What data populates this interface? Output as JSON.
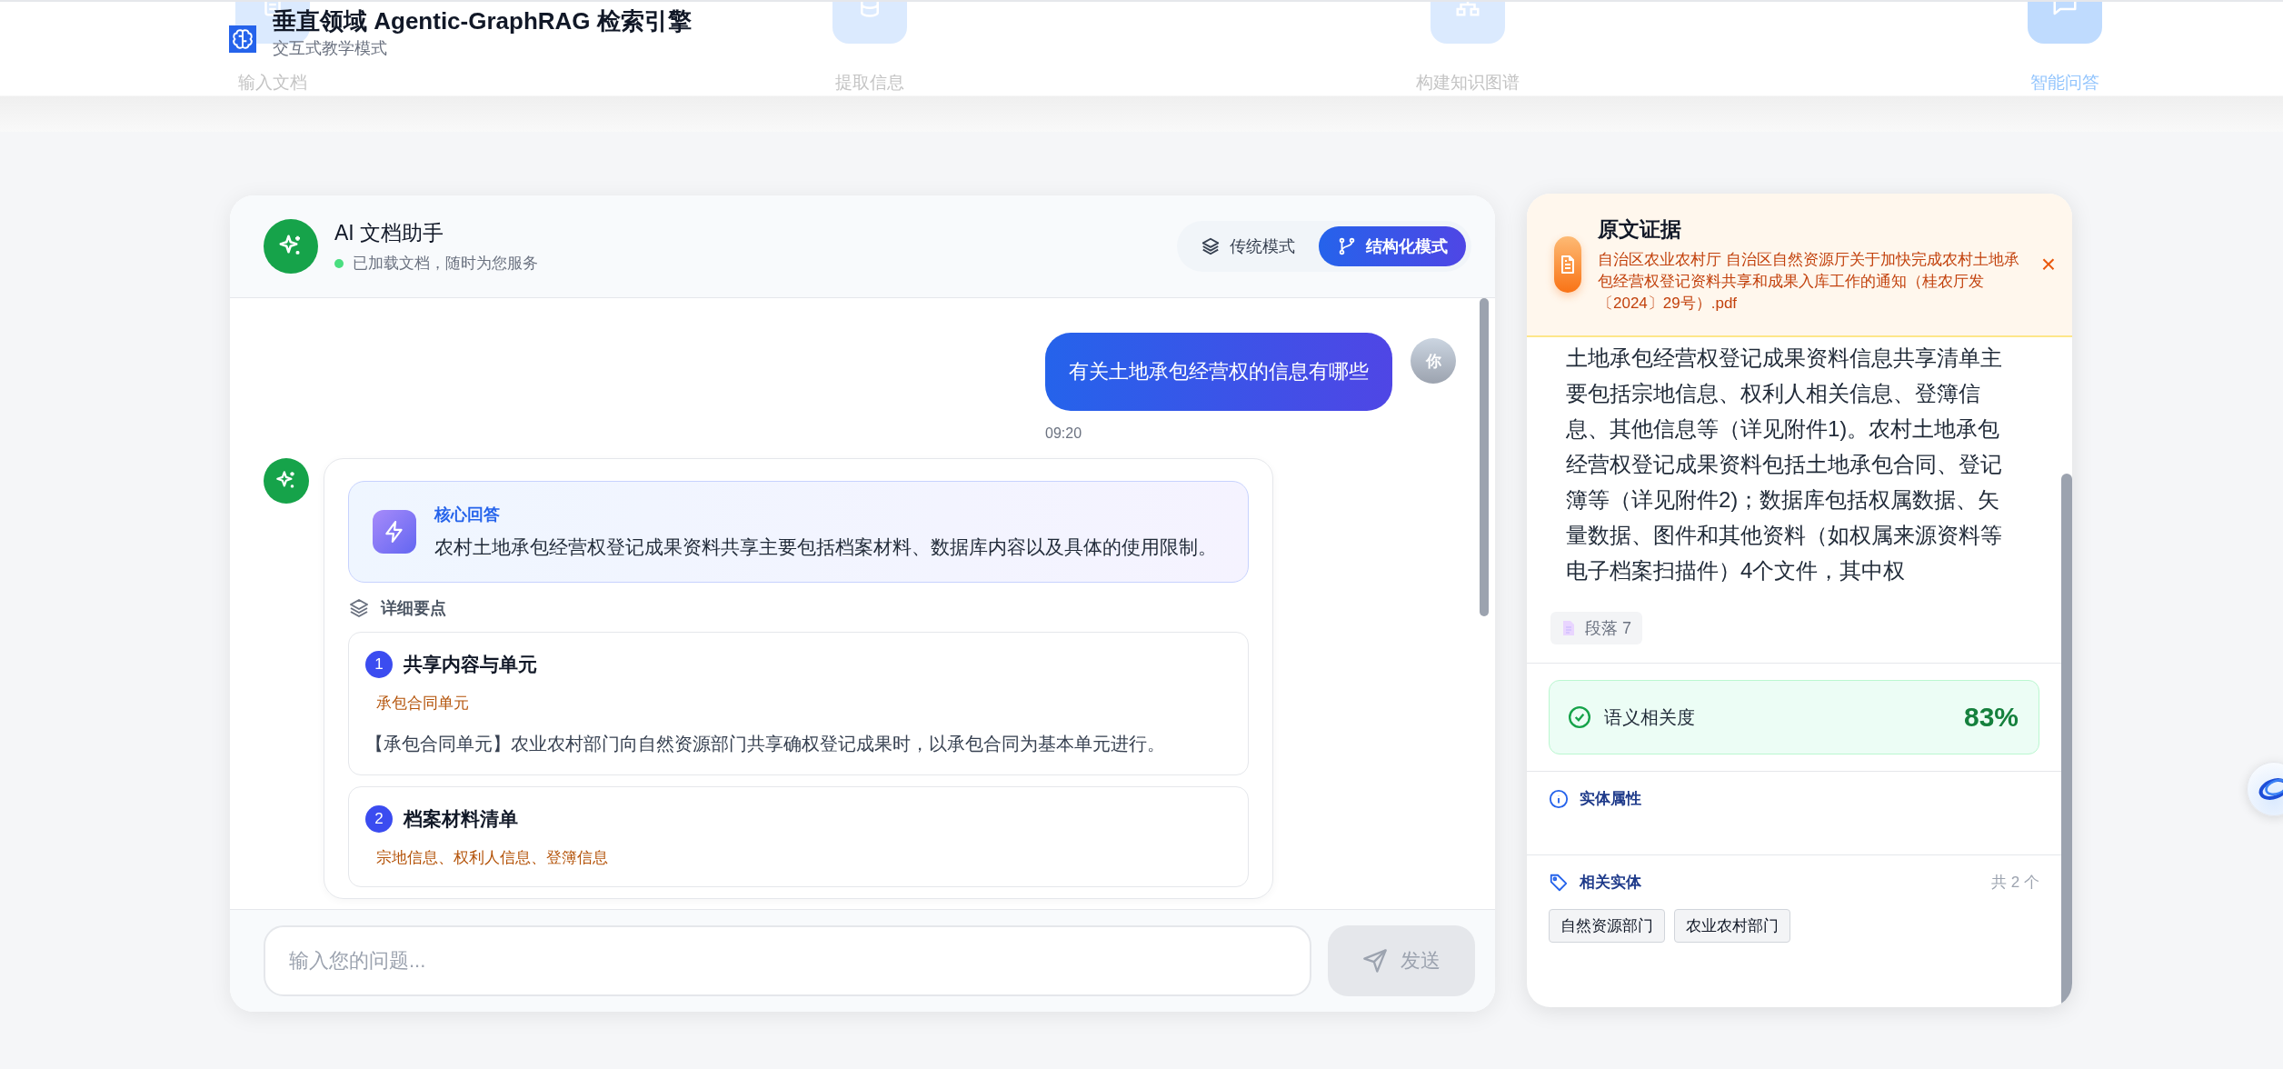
{
  "header": {
    "title": "垂直领域 Agentic-GraphRAG 检索引擎",
    "subtitle": "交互式教学模式",
    "steps": [
      {
        "label": "输入文档",
        "selected": false
      },
      {
        "label": "提取信息",
        "selected": false
      },
      {
        "label": "构建知识图谱",
        "selected": false
      },
      {
        "label": "智能问答",
        "selected": true
      }
    ]
  },
  "chat": {
    "title": "AI 文档助手",
    "status": "已加载文档，随时为您服务",
    "online": true,
    "modes": [
      {
        "label": "传统模式",
        "selected": false
      },
      {
        "label": "结构化模式",
        "selected": true
      }
    ],
    "messages": [
      {
        "kind": "user",
        "avatar": "你",
        "text": "有关土地承包经营权的信息有哪些",
        "time": "09:20"
      },
      {
        "kind": "assistant",
        "core": {
          "label": "核心回答",
          "text": "农村土地承包经营权登记成果资料共享主要包括档案材料、数据库内容以及具体的使用限制。"
        },
        "details_label": "详细要点",
        "points": [
          {
            "number": "1",
            "title": "共享内容与单元",
            "tag": "承包合同单元",
            "text": "【承包合同单元】农业农村部门向自然资源部门共享确权登记成果时，以承包合同为基本单元进行。"
          },
          {
            "number": "2",
            "title": "档案材料清单",
            "tag": "宗地信息、权利人信息、登簿信息"
          }
        ]
      }
    ],
    "input": {
      "placeholder": "输入您的问题..."
    },
    "send_button": {
      "label": "发送",
      "disabled": true
    }
  },
  "evidence": {
    "title": "原文证据",
    "close": "×",
    "source": "自治区农业农村厅 自治区自然资源厅关于加快完成农村土地承包经营权登记资料共享和成果入库工作的通知（桂农厅发〔2024〕29号）.pdf",
    "excerpt": "土地承包经营权登记成果资料信息共享清单主要包括宗地信息、权利人相关信息、登簿信息、其他信息等（详见附件1)。农村土地承包经营权登记成果资料包括土地承包合同、登记簿等（详见附件2)；数据库包括权属数据、矢量数据、图件和其他资料（如权属来源资料等电子档案扫描件）4个文件，其中权",
    "paragraph": "段落 7",
    "relevance": {
      "label": "语义相关度",
      "value": "83%"
    },
    "attributes_label": "实体属性",
    "entities": {
      "label": "相关实体",
      "count": "共 2 个",
      "items": [
        "自然资源部门",
        "农业农村部门"
      ]
    }
  }
}
